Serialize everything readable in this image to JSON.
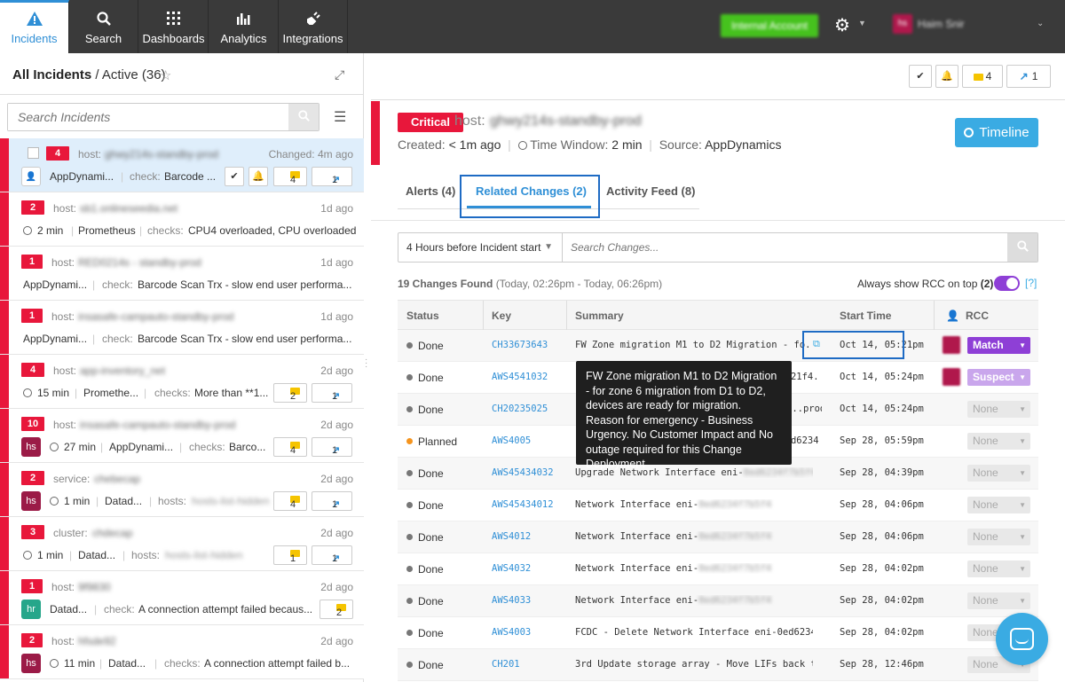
{
  "nav": {
    "items": [
      {
        "label": "Incidents",
        "icon": "warning-icon"
      },
      {
        "label": "Search",
        "icon": "search-icon"
      },
      {
        "label": "Dashboards",
        "icon": "grid-icon"
      },
      {
        "label": "Analytics",
        "icon": "bar-chart-icon"
      },
      {
        "label": "Integrations",
        "icon": "plug-icon"
      }
    ],
    "internal_account": "Internal Account",
    "user_initials": "hs",
    "user_name": "Haim Snir"
  },
  "left": {
    "title": "All Incidents",
    "subtitle": "/ Active (36)",
    "search_placeholder": "Search Incidents",
    "incidents": [
      {
        "count": "4",
        "type": "host:",
        "name": "ghwy214s-standby-prod",
        "time": "Changed: 4m ago",
        "source": "AppDynami...",
        "check_label": "check:",
        "check": "Barcode ...",
        "comments": "4",
        "shares": "1"
      },
      {
        "count": "2",
        "type": "host:",
        "name": "sb1.onlineseedia.net",
        "time": "1d ago",
        "duration": "2 min",
        "source": "Prometheus",
        "check_label": "checks:",
        "check": "CPU4 overloaded, CPU overloaded"
      },
      {
        "count": "1",
        "type": "host:",
        "name": "RED0214s - standby-prod",
        "time": "1d ago",
        "source": "AppDynami...",
        "check_label": "check:",
        "check": "Barcode Scan Trx - slow end user performa..."
      },
      {
        "count": "1",
        "type": "host:",
        "name": "insasafe-campauto-standby-prod",
        "time": "1d ago",
        "source": "AppDynami...",
        "check_label": "check:",
        "check": "Barcode Scan Trx - slow end user performa..."
      },
      {
        "count": "4",
        "type": "host:",
        "name": "app-inventory_net",
        "time": "2d ago",
        "duration": "15 min",
        "source": "Promethe...",
        "check_label": "checks:",
        "check": "More than **1...",
        "comments": "2",
        "shares": "1"
      },
      {
        "count": "10",
        "type": "host:",
        "name": "insasafe-campauto-standby-prod",
        "time": "2d ago",
        "avatar": "hs",
        "duration": "27 min",
        "source": "AppDynami...",
        "check_label": "checks:",
        "check": "Barco...",
        "comments": "4",
        "shares": "1"
      },
      {
        "count": "2",
        "type": "service:",
        "name": "chebecap",
        "time": "2d ago",
        "avatar": "hs",
        "duration": "1 min",
        "source": "Datad...",
        "check_label": "hosts:",
        "check": "hosts-list-hidden",
        "comments": "4",
        "shares": "1"
      },
      {
        "count": "3",
        "type": "cluster:",
        "name": "chdecap",
        "time": "2d ago",
        "duration": "1 min",
        "source": "Datad...",
        "check_label": "hosts:",
        "check": "hosts-list-hidden",
        "comments": "1",
        "shares": "1"
      },
      {
        "count": "1",
        "type": "host:",
        "name": "9f9830",
        "time": "2d ago",
        "avatar": "hr",
        "source": "Datad...",
        "check_label": "check:",
        "check": "A connection attempt failed becaus...",
        "comments": "2"
      },
      {
        "count": "2",
        "type": "host:",
        "name": "hfsde92",
        "time": "2d ago",
        "avatar": "hs",
        "duration": "11 min",
        "source": "Datad...",
        "check_label": "checks:",
        "check": "A connection attempt failed b..."
      }
    ]
  },
  "right": {
    "top_comments": "4",
    "top_shares": "1",
    "severity": "Critical",
    "host_label": "host:",
    "host": "ghwy214s-standby-prod",
    "created_label": "Created:",
    "created": "< 1m ago",
    "window_label": "Time Window:",
    "window": "2 min",
    "source_label": "Source:",
    "source": "AppDynamics",
    "timeline_label": "Timeline",
    "tabs": [
      "Alerts (4)",
      "Related Changes (2)",
      "Activity Feed (8)"
    ],
    "filter_range": "4 Hours before Incident start",
    "search_placeholder": "Search Changes...",
    "found": "19 Changes Found",
    "found_range": "(Today, 02:26pm - Today, 06:26pm)",
    "rcc_toggle_label": "Always show RCC on top",
    "rcc_count": "(2)",
    "help": "[?]",
    "columns": [
      "Status",
      "Key",
      "Summary",
      "Start Time",
      "RCC"
    ],
    "rows": [
      {
        "status": "Done",
        "key": "CH33673643",
        "summary": "FW Zone migration M1 to D2 Migration - fo...",
        "time": "Oct 14, 05:21pm",
        "rcc": "Match"
      },
      {
        "status": "Done",
        "key": "AWS4541032",
        "summary": "...21f4...",
        "time": "Oct 14, 05:24pm",
        "rcc": "Suspect"
      },
      {
        "status": "Done",
        "key": "CH20235025",
        "summary": "...prod",
        "time": "Oct 14, 05:24pm",
        "rcc": "None"
      },
      {
        "status": "Planned",
        "key": "AWS4005",
        "summary": "...d6234...",
        "time": "Sep 28, 05:59pm",
        "rcc": "None"
      },
      {
        "status": "Done",
        "key": "AWS45434032",
        "summary": "Upgrade Network Interface eni-",
        "summary_hidden": "0ed6234f7b5f4c",
        "time": "Sep 28, 04:39pm",
        "rcc": "None"
      },
      {
        "status": "Done",
        "key": "AWS45434012",
        "summary": "Network Interface eni-",
        "summary_hidden": "0ed6234f7b5f4",
        "time": "Sep 28, 04:06pm",
        "rcc": "None"
      },
      {
        "status": "Done",
        "key": "AWS4012",
        "summary": "Network Interface eni-",
        "summary_hidden": "0ed6234f7b5f4",
        "time": "Sep 28, 04:06pm",
        "rcc": "None"
      },
      {
        "status": "Done",
        "key": "AWS4032",
        "summary": "Network Interface eni-",
        "summary_hidden": "0ed6234f7b5f4",
        "time": "Sep 28, 04:02pm",
        "rcc": "None"
      },
      {
        "status": "Done",
        "key": "AWS4033",
        "summary": "Network Interface eni-",
        "summary_hidden": "0ed6234f7b5f4",
        "time": "Sep 28, 04:02pm",
        "rcc": "None"
      },
      {
        "status": "Done",
        "key": "AWS4003",
        "summary": "FCDC - Delete Network Interface eni-0ed6234...",
        "time": "Sep 28, 04:02pm",
        "rcc": "None"
      },
      {
        "status": "Done",
        "key": "CH201",
        "summary": "3rd Update storage array - Move LIFs back t...",
        "time": "Sep 28, 12:46pm",
        "rcc": "None"
      }
    ],
    "tooltip": "FW Zone migration M1 to D2 Migration - for zone 6 migration from D1 to D2, devices are ready for migration. Reason for emergency - Business Urgency. No Customer Impact and No outage required for this Change Deployment"
  }
}
